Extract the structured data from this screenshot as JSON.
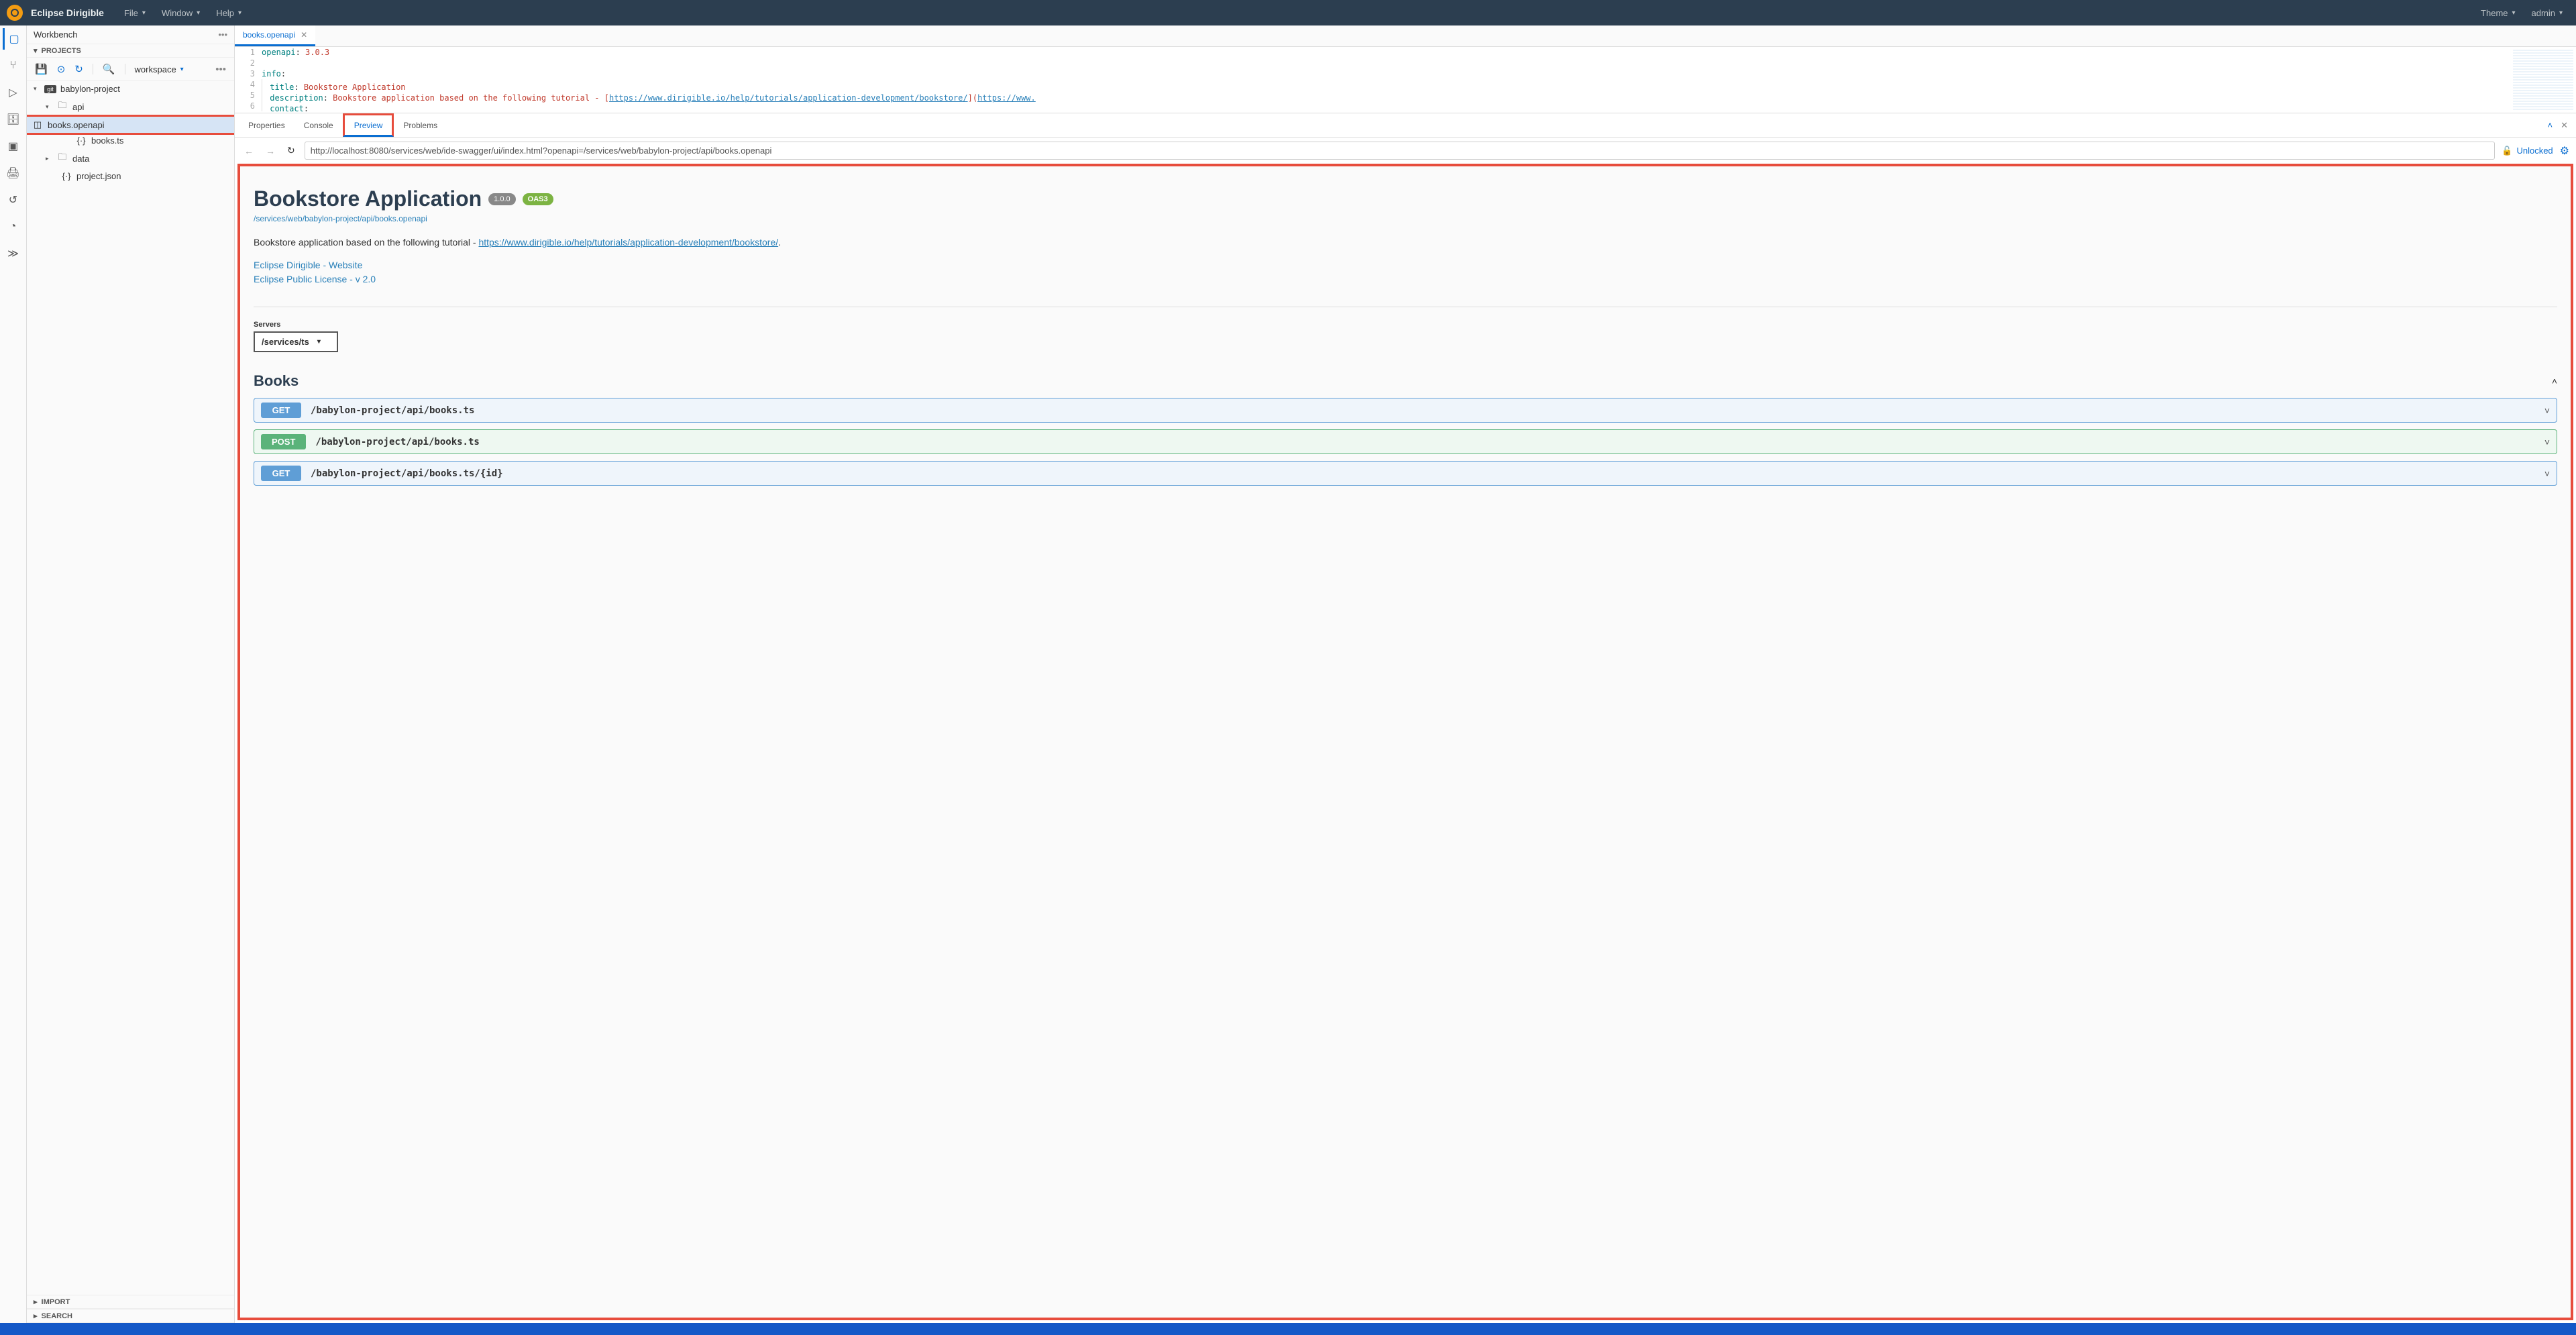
{
  "app": {
    "title": "Eclipse Dirigible"
  },
  "topmenu": {
    "file": "File",
    "window": "Window",
    "help": "Help",
    "theme": "Theme",
    "user": "admin"
  },
  "sidebar": {
    "title": "Workbench",
    "projects": "Projects",
    "import": "Import",
    "search": "Search",
    "workspace": "workspace"
  },
  "tree": {
    "project": "babylon-project",
    "api": "api",
    "file_openapi": "books.openapi",
    "file_ts": "books.ts",
    "data": "data",
    "projectjson": "project.json"
  },
  "editor": {
    "tab": "books.openapi",
    "lines": {
      "l1a": "openapi",
      "l1b": ": ",
      "l1c": "3.0.3",
      "l3": "info",
      "l3b": ":",
      "l4a": "title",
      "l4b": ": ",
      "l4c": "Bookstore Application",
      "l5a": "description",
      "l5b": ": ",
      "l5c": "Bookstore application based on the following tutorial - [",
      "l5d": "https://www.dirigible.io/help/tutorials/application-development/bookstore/",
      "l5e": "](",
      "l5f": "https://www.",
      "l6a": "contact",
      "l6b": ":"
    }
  },
  "bottomTabs": {
    "properties": "Properties",
    "console": "Console",
    "preview": "Preview",
    "problems": "Problems"
  },
  "preview": {
    "url": "http://localhost:8080/services/web/ide-swagger/ui/index.html?openapi=/services/web/babylon-project/api/books.openapi",
    "unlocked": "Unlocked"
  },
  "swagger": {
    "title": "Bookstore Application",
    "version": "1.0.0",
    "oas": "OAS3",
    "specUrl": "/services/web/babylon-project/api/books.openapi",
    "descPrefix": "Bookstore application based on the following tutorial - ",
    "descLink": "https://www.dirigible.io/help/tutorials/application-development/bookstore/",
    "link1": "Eclipse Dirigible - Website",
    "link2": "Eclipse Public License - v 2.0",
    "serversLabel": "Servers",
    "server": "/services/ts",
    "tag": "Books",
    "ops": [
      {
        "method": "GET",
        "cls": "get",
        "path": "/babylon-project/api/books.ts"
      },
      {
        "method": "POST",
        "cls": "post",
        "path": "/babylon-project/api/books.ts"
      },
      {
        "method": "GET",
        "cls": "get",
        "path": "/babylon-project/api/books.ts/{id}"
      }
    ]
  }
}
